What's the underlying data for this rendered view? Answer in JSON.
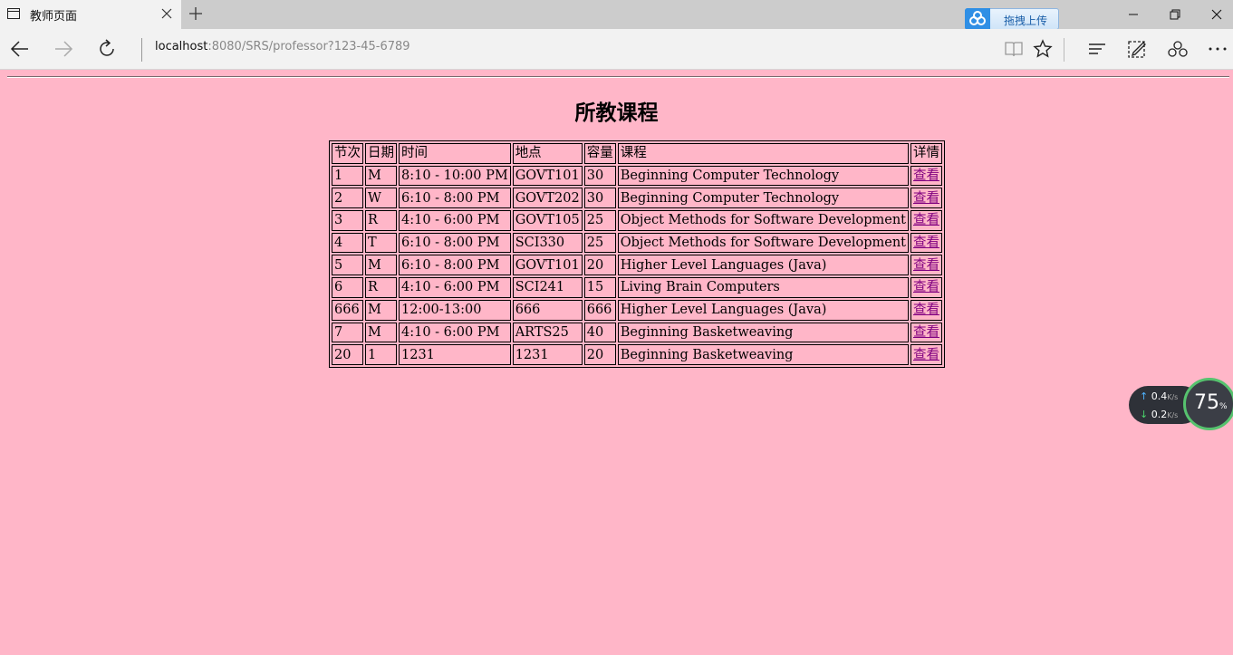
{
  "browser": {
    "tab_title": "教师页面",
    "url_host": "localhost",
    "url_rest": ":8080/SRS/professor?123-45-6789",
    "upload_label": "拖拽上传"
  },
  "page": {
    "title": "所教课程",
    "table": {
      "headers": [
        "节次",
        "日期",
        "时间",
        "地点",
        "容量",
        "课程",
        "详情"
      ],
      "rows": [
        [
          "1",
          "M",
          "8:10 - 10:00 PM",
          "GOVT101",
          "30",
          "Beginning Computer Technology",
          "查看"
        ],
        [
          "2",
          "W",
          "6:10 - 8:00 PM",
          "GOVT202",
          "30",
          "Beginning Computer Technology",
          "查看"
        ],
        [
          "3",
          "R",
          "4:10 - 6:00 PM",
          "GOVT105",
          "25",
          "Object Methods for Software Development",
          "查看"
        ],
        [
          "4",
          "T",
          "6:10 - 8:00 PM",
          "SCI330",
          "25",
          "Object Methods for Software Development",
          "查看"
        ],
        [
          "5",
          "M",
          "6:10 - 8:00 PM",
          "GOVT101",
          "20",
          "Higher Level Languages (Java)",
          "查看"
        ],
        [
          "6",
          "R",
          "4:10 - 6:00 PM",
          "SCI241",
          "15",
          "Living Brain Computers",
          "查看"
        ],
        [
          "666",
          "M",
          "12:00-13:00",
          "666",
          "666",
          "Higher Level Languages (Java)",
          "查看"
        ],
        [
          "7",
          "M",
          "4:10 - 6:00 PM",
          "ARTS25",
          "40",
          "Beginning Basketweaving",
          "查看"
        ],
        [
          "20",
          "1",
          "1231",
          "1231",
          "20",
          "Beginning Basketweaving",
          "查看"
        ]
      ]
    }
  },
  "speed_widget": {
    "up": "0.4",
    "down": "0.2",
    "unit": "K/s",
    "percent": "75",
    "percent_sign": "%"
  },
  "colors": {
    "page_background": "#ffb6c8",
    "link": "#800080"
  }
}
